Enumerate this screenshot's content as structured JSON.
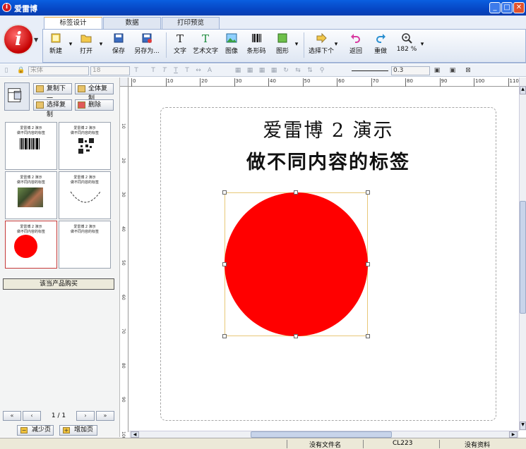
{
  "window": {
    "title": "爱雷博"
  },
  "ribbon": {
    "tabs": [
      {
        "label": "标签设计",
        "active": true
      },
      {
        "label": "数据",
        "active": false
      },
      {
        "label": "打印预览",
        "active": false
      }
    ],
    "buttons": {
      "new": "新建",
      "open": "打开",
      "save": "保存",
      "save_as": "另存为...",
      "text": "文字",
      "art_text": "艺术文字",
      "image": "图像",
      "barcode": "条形码",
      "shape": "图形",
      "select_next": "选择下个",
      "undo": "返回",
      "redo": "重做",
      "zoom": "182 %"
    }
  },
  "format_bar": {
    "font_name": "宋体",
    "font_size": "18",
    "line_width": "0.3"
  },
  "left_panel": {
    "copy_next": "复制下一",
    "copy_all": "全体复制",
    "select_copy": "选择复制",
    "delete": "删除",
    "thumb_line1": "爱雷博 2 演示",
    "thumb_line2": "做不同内容的标签",
    "buy_button": "该当产品购买",
    "page_indicator": "1 / 1",
    "reduce_page": "减少页",
    "add_page": "增加页"
  },
  "canvas": {
    "line1": "爱雷博 2 演示",
    "line2": "做不同内容的标签",
    "circle_color": "#ff0000",
    "ruler_h": [
      "0",
      "10",
      "20",
      "30",
      "40",
      "50",
      "60",
      "70",
      "80",
      "90",
      "100",
      "110"
    ],
    "ruler_v": [
      "10",
      "20",
      "30",
      "40",
      "50",
      "60",
      "70",
      "80",
      "90",
      "100"
    ]
  },
  "status": {
    "file": "没有文件名",
    "printer": "CL223",
    "data": "没有资料"
  }
}
